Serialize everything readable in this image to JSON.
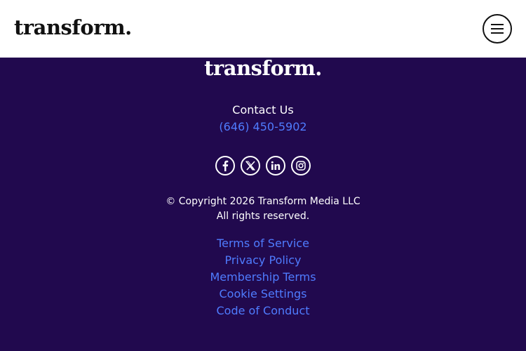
{
  "header": {
    "logo": "transform."
  },
  "footer": {
    "logo": "transform.",
    "contact_label": "Contact Us",
    "phone": "(646) 450-5902",
    "social": [
      "facebook-icon",
      "x-icon",
      "linkedin-icon",
      "instagram-icon"
    ],
    "copyright_line1": "© Copyright 2026 Transform Media LLC",
    "copyright_line2": "All rights reserved.",
    "links": [
      "Terms of Service",
      "Privacy Policy",
      "Membership Terms",
      "Cookie Settings",
      "Code of Conduct"
    ]
  },
  "colors": {
    "background": "#21094e",
    "link": "#4f7cff",
    "header_bg": "#ffffff"
  }
}
